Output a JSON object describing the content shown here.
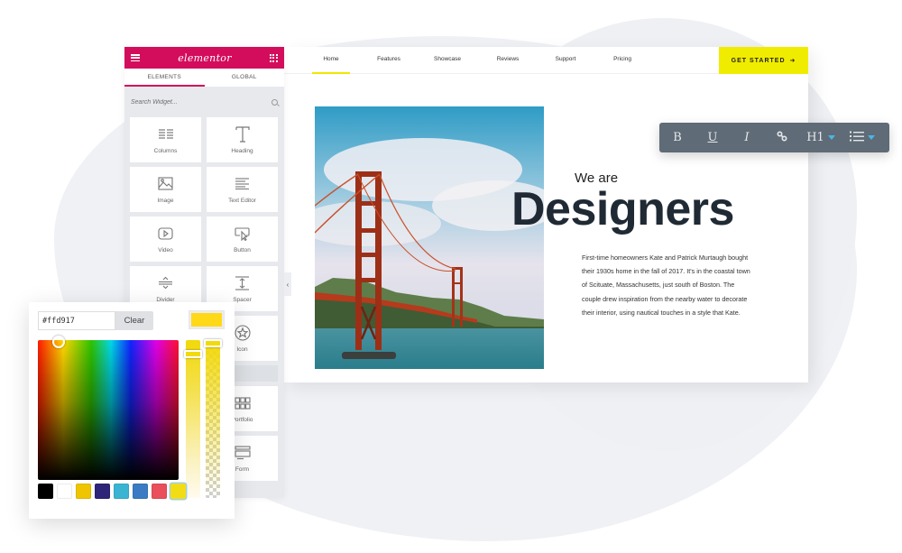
{
  "sidebar": {
    "logo": "elementor",
    "tabs": [
      {
        "label": "ELEMENTS",
        "active": true
      },
      {
        "label": "GLOBAL",
        "active": false
      }
    ],
    "search_placeholder": "Search Widget...",
    "widgets": [
      {
        "label": "Columns",
        "icon": "columns-icon"
      },
      {
        "label": "Heading",
        "icon": "heading-icon"
      },
      {
        "label": "Image",
        "icon": "image-icon"
      },
      {
        "label": "Text Editor",
        "icon": "text-editor-icon"
      },
      {
        "label": "Video",
        "icon": "video-icon"
      },
      {
        "label": "Button",
        "icon": "button-icon"
      },
      {
        "label": "Divider",
        "icon": "divider-icon"
      },
      {
        "label": "Spacer",
        "icon": "spacer-icon"
      },
      {
        "label": "Icon",
        "icon": "star-icon"
      },
      {
        "label": "Portfolio",
        "icon": "portfolio-icon"
      },
      {
        "label": "Form",
        "icon": "form-icon"
      }
    ],
    "collapse_glyph": "‹"
  },
  "nav": {
    "items": [
      {
        "label": "Home",
        "active": true
      },
      {
        "label": "Features",
        "active": false
      },
      {
        "label": "Showcase",
        "active": false
      },
      {
        "label": "Reviews",
        "active": false
      },
      {
        "label": "Support",
        "active": false
      },
      {
        "label": "Pricing",
        "active": false
      }
    ],
    "cta_label": "GET STARTED",
    "cta_arrow": "➜"
  },
  "hero": {
    "subtitle": "We are",
    "title": "Designers",
    "body": "First-time homeowners Kate and Patrick Murtaugh bought their 1930s home in the fall of 2017. It's in the coastal town of Scituate, Massachusetts, just south of Boston. The couple drew inspiration from the nearby water to decorate their interior, using nautical touches in a style that Kate."
  },
  "toolbar": {
    "buttons": [
      {
        "name": "bold",
        "glyph": "B"
      },
      {
        "name": "underline",
        "glyph": "U"
      },
      {
        "name": "italic",
        "glyph": "I"
      },
      {
        "name": "link",
        "glyph": "link"
      },
      {
        "name": "heading",
        "glyph": "H1"
      },
      {
        "name": "list",
        "glyph": "list"
      }
    ]
  },
  "color_picker": {
    "hex_value": "#ffd917",
    "clear_label": "Clear",
    "current_color": "#ffd917",
    "swatches": [
      "#000000",
      "#ffffff",
      "#efc500",
      "#2e2478",
      "#3ab4d2",
      "#3a7bc4",
      "#e9505b",
      "#f2dd14"
    ],
    "selected_swatch_index": 7
  },
  "colors": {
    "brand": "#d30c5c",
    "accent_yellow": "#f0ec00",
    "toolbar_bg": "#5f6b76",
    "caret_blue": "#4ab5e8",
    "heading_dark": "#1f2a35"
  }
}
